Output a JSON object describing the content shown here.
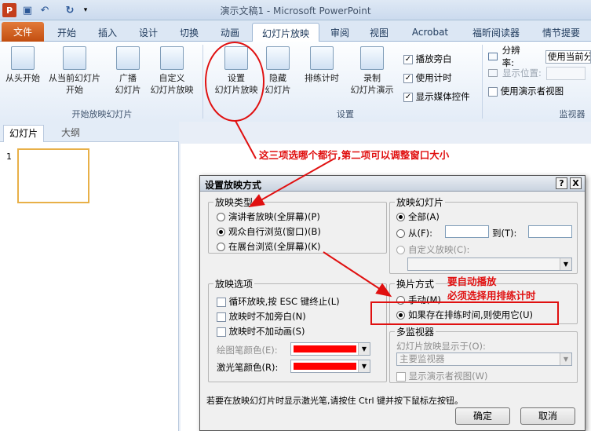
{
  "window": {
    "title": "演示文稿1 - Microsoft PowerPoint"
  },
  "tabs": [
    "文件",
    "开始",
    "插入",
    "设计",
    "切换",
    "动画",
    "幻灯片放映",
    "审阅",
    "视图",
    "Acrobat",
    "福昕阅读器",
    "情节提要"
  ],
  "ribbon": {
    "group1": {
      "b1": "从头开始",
      "b2": "从当前幻灯片",
      "b2b": "开始",
      "b3": "广播",
      "b3b": "幻灯片",
      "b4": "自定义",
      "b4b": "幻灯片放映",
      "label": "开始放映幻灯片"
    },
    "group2": {
      "b1": "设置",
      "b1b": "幻灯片放映",
      "b2": "隐藏",
      "b2b": "幻灯片",
      "b3": "排练计时",
      "b4": "录制",
      "b4b": "幻灯片演示",
      "c1": "播放旁白",
      "c2": "使用计时",
      "c3": "显示媒体控件",
      "label": "设置"
    },
    "group3": {
      "res_label": "分辨率:",
      "res_value": "使用当前分",
      "pos_label": "显示位置:",
      "presenter": "使用演示者视图",
      "label": "监视器"
    }
  },
  "pane": {
    "tab1": "幻灯片",
    "tab2": "大纲",
    "slide_number": "1"
  },
  "annotations": {
    "top": "这三项选哪个都行,第二项可以调整窗口大小",
    "right1": "要自动播放",
    "right2": "必须选择用排练计时"
  },
  "dialog": {
    "title": "设置放映方式",
    "help": "?",
    "close": "X",
    "type": {
      "label": "放映类型",
      "o1": "演讲者放映(全屏幕)(P)",
      "o2": "观众自行浏览(窗口)(B)",
      "o3": "在展台浏览(全屏幕)(K)"
    },
    "slides": {
      "label": "放映幻灯片",
      "all": "全部(A)",
      "from": "从(F):",
      "to": "到(T):",
      "custom": "自定义放映(C):"
    },
    "options": {
      "label": "放映选项",
      "o1": "循环放映,按 ESC 键终止(L)",
      "o2": "放映时不加旁白(N)",
      "o3": "放映时不加动画(S)",
      "pen": "绘图笔颜色(E):",
      "laser": "激光笔颜色(R):"
    },
    "advance": {
      "label": "换片方式",
      "manual": "手动(M)",
      "timing": "如果存在排练时间,则使用它(U)"
    },
    "monitor": {
      "label": "多监视器",
      "show_on": "幻灯片放映显示于(O):",
      "value": "主要监视器",
      "presenter": "显示演示者视图(W)"
    },
    "hint": "若要在放映幻灯片时显示激光笔,请按住 Ctrl 键并按下鼠标左按钮。",
    "ok": "确定",
    "cancel": "取消"
  },
  "colors": {
    "pen": "#ff0000",
    "laser": "#ff0000",
    "annotation": "#e01010"
  }
}
